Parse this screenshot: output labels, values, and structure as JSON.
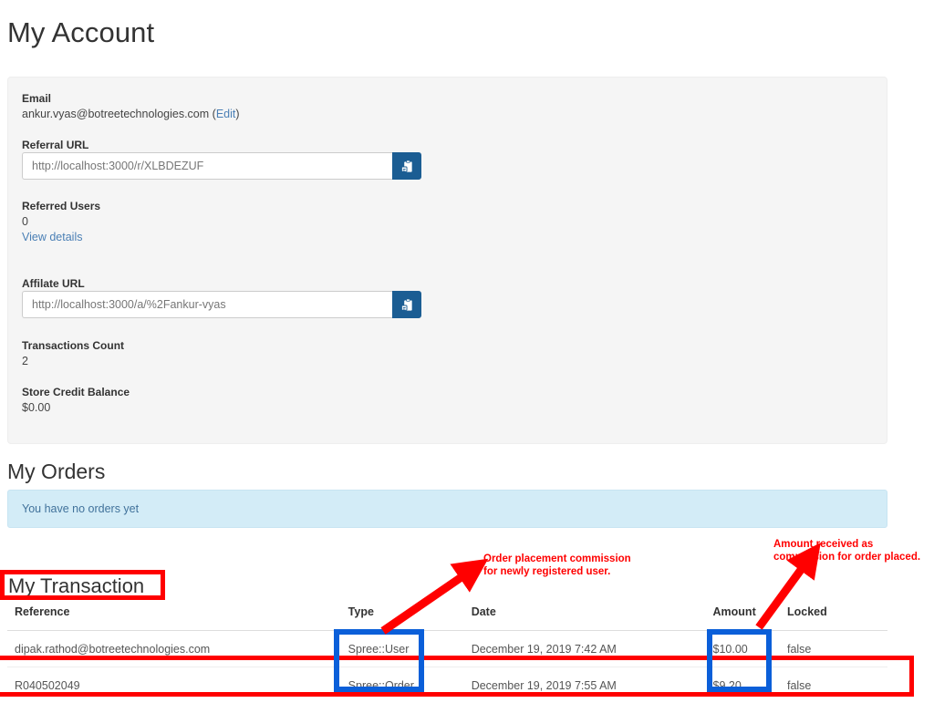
{
  "page": {
    "title": "My Account",
    "orders_title": "My Orders",
    "transactions_title": "My Transaction"
  },
  "account": {
    "email_label": "Email",
    "email_value": "ankur.vyas@botreetechnologies.com",
    "email_edit_open": " (",
    "email_edit_link": "Edit",
    "email_edit_close": ")",
    "referral_label": "Referral URL",
    "referral_url": "http://localhost:3000/r/XLBDEZUF",
    "referral_copy_icon": "clipboard-paste-icon",
    "referred_users_label": "Referred Users",
    "referred_users_count": "0",
    "view_details_link": "View details",
    "affiliate_label": "Affilate URL",
    "affiliate_url": "http://localhost:3000/a/%2Fankur-vyas",
    "affiliate_copy_icon": "clipboard-paste-icon",
    "transactions_count_label": "Transactions Count",
    "transactions_count_value": "2",
    "store_credit_label": "Store Credit Balance",
    "store_credit_value": "$0.00"
  },
  "orders": {
    "empty_message": "You have no orders yet"
  },
  "transactions": {
    "columns": [
      "Reference",
      "Type",
      "Date",
      "Amount",
      "Locked"
    ],
    "rows": [
      {
        "reference": "dipak.rathod@botreetechnologies.com",
        "type": "Spree::User",
        "date": "December 19, 2019 7:42 AM",
        "amount": "$10.00",
        "locked": "false"
      },
      {
        "reference": "R040502049",
        "type": "Spree::Order",
        "date": "December 19, 2019 7:55 AM",
        "amount": "$9.20",
        "locked": "false"
      }
    ]
  },
  "annotations": {
    "note_1": "Order placement commission\nfor newly registered user.",
    "note_2": "Amount received as\ncommission for order placed.",
    "highlight_color_red": "#ff0000",
    "highlight_color_blue": "#0b5fd9"
  },
  "colors": {
    "panel_background": "#f5f5f5",
    "button_blue": "#1b5d93",
    "alert_background": "#d3ecf7",
    "alert_text": "#41729b",
    "link": "#4a7fb5"
  }
}
